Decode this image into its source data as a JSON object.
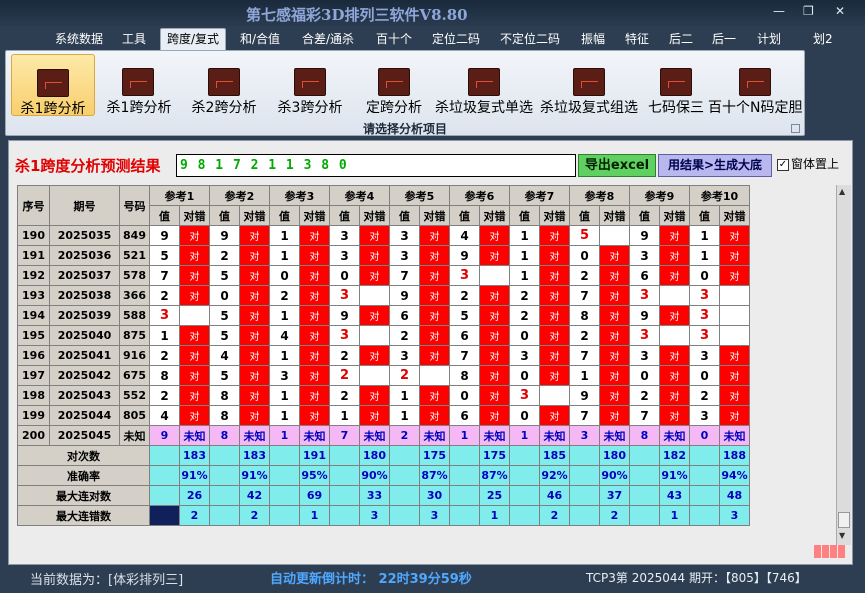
{
  "window": {
    "title": "第七感福彩3D排列三软件V8.80",
    "min": "—",
    "restore": "❐",
    "close": "✕"
  },
  "menu": [
    "系统数据",
    "工具",
    "跨度/复式",
    "和/合值",
    "合差/通杀",
    "百十个",
    "定位二码",
    "不定位二码",
    "振幅",
    "特征",
    "后二",
    "后一",
    "计划",
    "划2"
  ],
  "active_menu": "跨度/复式",
  "ribbon": {
    "buttons": [
      "杀1跨分析",
      "杀1跨分析",
      "杀2跨分析",
      "杀3跨分析",
      "定跨分析",
      "杀垃圾复式单选",
      "杀垃圾复式组选",
      "七码保三",
      "百十个N码定胆"
    ],
    "caption": "请选择分析项目"
  },
  "result": {
    "label": "杀1跨度分析预测结果",
    "value": "9 8 1 7 2 1 1 3 8 0",
    "export_label": "导出excel",
    "big_label": "用结果>生成大底",
    "ontop_label": "窗体置上",
    "ontop_checked": "✓"
  },
  "table": {
    "col_headers": [
      "序号",
      "期号",
      "号码"
    ],
    "groups": [
      "参考1",
      "参考2",
      "参考3",
      "参考4",
      "参考5",
      "参考6",
      "参考7",
      "参考8",
      "参考9",
      "参考10"
    ],
    "sub_headers": [
      "值",
      "对错"
    ],
    "rows": [
      {
        "seq": "190",
        "issue": "2025035",
        "num": "849",
        "cells": [
          [
            "9",
            "对"
          ],
          [
            "9",
            "对"
          ],
          [
            "1",
            "对"
          ],
          [
            "3",
            "对"
          ],
          [
            "3",
            "对"
          ],
          [
            "4",
            "对"
          ],
          [
            "1",
            "对"
          ],
          [
            "5",
            ""
          ],
          [
            "9",
            "对"
          ],
          [
            "1",
            "对"
          ]
        ]
      },
      {
        "seq": "191",
        "issue": "2025036",
        "num": "521",
        "cells": [
          [
            "5",
            "对"
          ],
          [
            "2",
            "对"
          ],
          [
            "1",
            "对"
          ],
          [
            "3",
            "对"
          ],
          [
            "3",
            "对"
          ],
          [
            "9",
            "对"
          ],
          [
            "1",
            "对"
          ],
          [
            "0",
            "对"
          ],
          [
            "3",
            "对"
          ],
          [
            "1",
            "对"
          ]
        ]
      },
      {
        "seq": "192",
        "issue": "2025037",
        "num": "578",
        "cells": [
          [
            "7",
            "对"
          ],
          [
            "5",
            "对"
          ],
          [
            "0",
            "对"
          ],
          [
            "0",
            "对"
          ],
          [
            "7",
            "对"
          ],
          [
            "3",
            ""
          ],
          [
            "1",
            "对"
          ],
          [
            "2",
            "对"
          ],
          [
            "6",
            "对"
          ],
          [
            "0",
            "对"
          ]
        ]
      },
      {
        "seq": "193",
        "issue": "2025038",
        "num": "366",
        "cells": [
          [
            "2",
            "对"
          ],
          [
            "0",
            "对"
          ],
          [
            "2",
            "对"
          ],
          [
            "3",
            ""
          ],
          [
            "9",
            "对"
          ],
          [
            "2",
            "对"
          ],
          [
            "2",
            "对"
          ],
          [
            "7",
            "对"
          ],
          [
            "3",
            ""
          ],
          [
            "3",
            ""
          ]
        ]
      },
      {
        "seq": "194",
        "issue": "2025039",
        "num": "588",
        "cells": [
          [
            "3",
            ""
          ],
          [
            "5",
            "对"
          ],
          [
            "1",
            "对"
          ],
          [
            "9",
            "对"
          ],
          [
            "6",
            "对"
          ],
          [
            "5",
            "对"
          ],
          [
            "2",
            "对"
          ],
          [
            "8",
            "对"
          ],
          [
            "9",
            "对"
          ],
          [
            "3",
            ""
          ]
        ]
      },
      {
        "seq": "195",
        "issue": "2025040",
        "num": "875",
        "cells": [
          [
            "1",
            "对"
          ],
          [
            "5",
            "对"
          ],
          [
            "4",
            "对"
          ],
          [
            "3",
            ""
          ],
          [
            "2",
            "对"
          ],
          [
            "6",
            "对"
          ],
          [
            "0",
            "对"
          ],
          [
            "2",
            "对"
          ],
          [
            "3",
            ""
          ],
          [
            "3",
            ""
          ]
        ]
      },
      {
        "seq": "196",
        "issue": "2025041",
        "num": "916",
        "cells": [
          [
            "2",
            "对"
          ],
          [
            "4",
            "对"
          ],
          [
            "1",
            "对"
          ],
          [
            "2",
            "对"
          ],
          [
            "3",
            "对"
          ],
          [
            "7",
            "对"
          ],
          [
            "3",
            "对"
          ],
          [
            "7",
            "对"
          ],
          [
            "3",
            "对"
          ],
          [
            "3",
            "对"
          ]
        ]
      },
      {
        "seq": "197",
        "issue": "2025042",
        "num": "675",
        "cells": [
          [
            "8",
            "对"
          ],
          [
            "5",
            "对"
          ],
          [
            "3",
            "对"
          ],
          [
            "2",
            ""
          ],
          [
            "2",
            ""
          ],
          [
            "8",
            "对"
          ],
          [
            "0",
            "对"
          ],
          [
            "1",
            "对"
          ],
          [
            "0",
            "对"
          ],
          [
            "0",
            "对"
          ]
        ]
      },
      {
        "seq": "198",
        "issue": "2025043",
        "num": "552",
        "cells": [
          [
            "2",
            "对"
          ],
          [
            "8",
            "对"
          ],
          [
            "1",
            "对"
          ],
          [
            "2",
            "对"
          ],
          [
            "1",
            "对"
          ],
          [
            "0",
            "对"
          ],
          [
            "3",
            ""
          ],
          [
            "9",
            "对"
          ],
          [
            "2",
            "对"
          ],
          [
            "2",
            "对"
          ]
        ]
      },
      {
        "seq": "199",
        "issue": "2025044",
        "num": "805",
        "cells": [
          [
            "4",
            "对"
          ],
          [
            "8",
            "对"
          ],
          [
            "1",
            "对"
          ],
          [
            "1",
            "对"
          ],
          [
            "1",
            "对"
          ],
          [
            "6",
            "对"
          ],
          [
            "0",
            "对"
          ],
          [
            "7",
            "对"
          ],
          [
            "7",
            "对"
          ],
          [
            "3",
            "对"
          ]
        ]
      }
    ],
    "pending": {
      "seq": "200",
      "issue": "2025045",
      "num": "未知",
      "values": [
        "9",
        "8",
        "1",
        "7",
        "2",
        "1",
        "1",
        "3",
        "8",
        "0"
      ],
      "status": "未知"
    },
    "stats": [
      {
        "label": "对次数",
        "values": [
          "183",
          "183",
          "191",
          "180",
          "175",
          "175",
          "185",
          "180",
          "182",
          "188"
        ]
      },
      {
        "label": "准确率",
        "values": [
          "91%",
          "91%",
          "95%",
          "90%",
          "87%",
          "87%",
          "92%",
          "90%",
          "91%",
          "94%"
        ]
      },
      {
        "label": "最大连对数",
        "values": [
          "26",
          "42",
          "69",
          "33",
          "30",
          "25",
          "46",
          "37",
          "43",
          "48"
        ]
      },
      {
        "label": "最大连错数",
        "values": [
          "2",
          "2",
          "1",
          "3",
          "3",
          "1",
          "2",
          "2",
          "1",
          "3"
        ]
      }
    ]
  },
  "status": {
    "left": "当前数据为：[体彩排列三]",
    "mid": "自动更新倒计时： 22时39分59秒",
    "right": "TCP3第 2025044 期开：【805】【746】"
  },
  "colors": {
    "correct_cell": "#ff0000",
    "pending_row": "#f4b8f4",
    "stats_row": "#80ecec",
    "accent_title": "#8fa6d8"
  },
  "highlights": [
    [
      0,
      7
    ],
    [
      2,
      5
    ],
    [
      3,
      3
    ],
    [
      3,
      8
    ],
    [
      3,
      9
    ],
    [
      4,
      0
    ],
    [
      4,
      9
    ],
    [
      5,
      3
    ],
    [
      5,
      8
    ],
    [
      5,
      9
    ],
    [
      7,
      3
    ],
    [
      7,
      4
    ],
    [
      8,
      6
    ]
  ]
}
